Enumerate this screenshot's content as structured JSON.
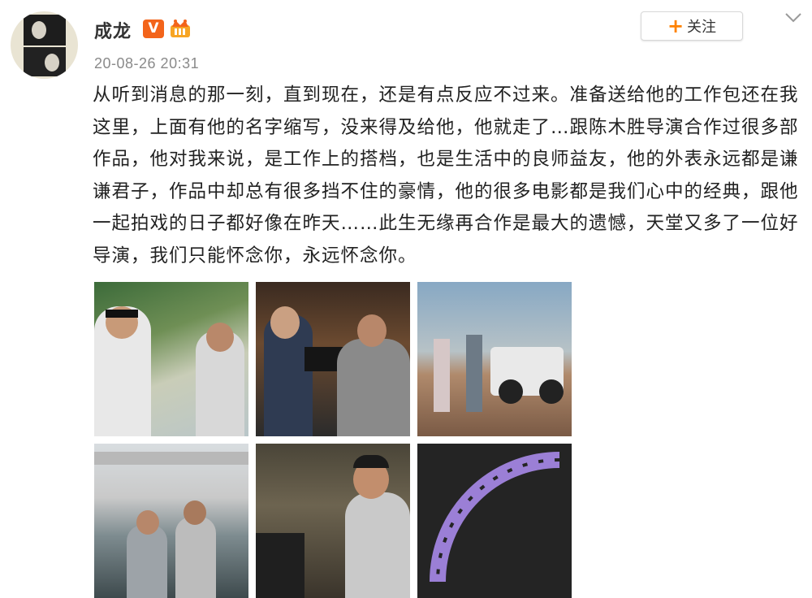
{
  "user": {
    "name": "成龙",
    "verified_badge": "V",
    "timestamp": "20-08-26 20:31"
  },
  "actions": {
    "follow_label": "关注",
    "follow_plus": "+"
  },
  "post": {
    "text": "从听到消息的那一刻，直到现在，还是有点反应不过来。准备送给他的工作包还在我这里，上面有他的名字缩写，没来得及给他，他就走了…跟陈木胜导演合作过很多部作品，他对我来说，是工作上的搭档，也是生活中的良师益友，他的外表永远都是谦谦君子，作品中却总有很多挡不住的豪情，他的很多电影都是我们心中的经典，跟他一起拍戏的日子都好像在昨天……此生无缘再合作是最大的遗憾，天堂又多了一位好导演，我们只能怀念你，永远怀念你。"
  },
  "images": [
    {
      "name": "photo-1"
    },
    {
      "name": "photo-2"
    },
    {
      "name": "photo-3"
    },
    {
      "name": "photo-4"
    },
    {
      "name": "photo-5"
    },
    {
      "name": "photo-6"
    }
  ],
  "icons": {
    "verified": "verified-v-icon",
    "crown": "vip-crown-icon",
    "menu": "chevron-down-icon"
  },
  "colors": {
    "accent_orange": "#ff8200",
    "verified_orange": "#f3641a",
    "timestamp_gray": "#8a8a8a"
  }
}
